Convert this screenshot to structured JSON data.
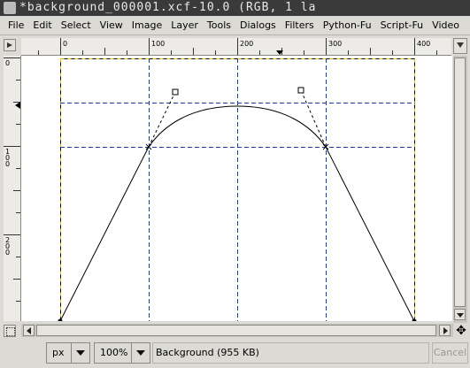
{
  "window": {
    "title": "*background_000001.xcf-10.0 (RGB, 1 la"
  },
  "menubar": {
    "items": [
      "File",
      "Edit",
      "Select",
      "View",
      "Image",
      "Layer",
      "Tools",
      "Dialogs",
      "Filters",
      "Python-Fu",
      "Script-Fu",
      "Video"
    ]
  },
  "rulers": {
    "horizontal_labels": [
      "0",
      "100",
      "200",
      "300",
      "400"
    ],
    "vertical_labels": [
      "0",
      "100",
      "200"
    ]
  },
  "statusbar": {
    "unit": "px",
    "zoom": "100%",
    "status_text": "Background (955 KB)",
    "cancel_label": "Cancel"
  },
  "colors": {
    "guide": "#1c3a9e",
    "boundary": "#d8c000",
    "path": "#000000"
  },
  "icons": {
    "navigate": "navigation-icon",
    "quick_mask": "quick-mask-icon",
    "move_view": "move-cross-icon",
    "menu_arrow": "image-menu-icon"
  }
}
